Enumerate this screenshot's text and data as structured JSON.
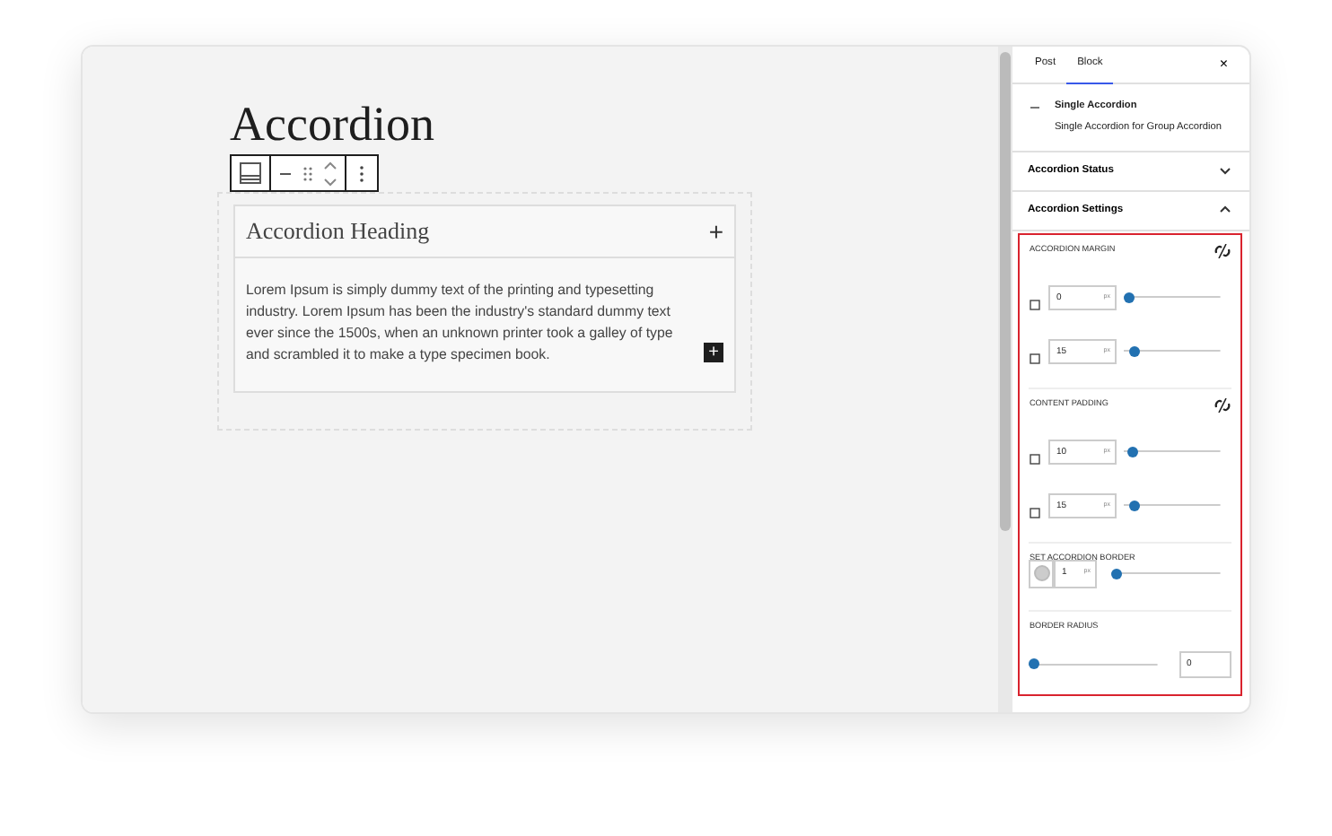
{
  "page_title": "Accordion",
  "accordion": {
    "heading": "Accordion Heading",
    "toggle": "+",
    "expanded": true,
    "body": "Lorem Ipsum is simply dummy text of the printing and typesetting industry. Lorem Ipsum has been the industry's standard dummy text ever since the 1500s, when an unknown printer took a galley of type and scrambled it to make a type specimen book.",
    "add_button": "+"
  },
  "sidebar": {
    "tabs": [
      {
        "label": "Post",
        "selected": false
      },
      {
        "label": "Block",
        "selected": true
      }
    ],
    "close": "×",
    "block": {
      "name": "Single Accordion",
      "description": "Single Accordion for Group Accordion"
    },
    "panels": [
      {
        "title": "Accordion Status",
        "expanded": false
      },
      {
        "title": "Accordion Settings",
        "expanded": true
      }
    ],
    "groups": [
      {
        "kind": "sides",
        "label": "ACCORDION MARGIN",
        "linked": false,
        "rows": [
          {
            "value": "0",
            "unit": "px",
            "level": 0
          },
          {
            "value": "15",
            "unit": "px",
            "level": 0.05
          }
        ]
      },
      {
        "kind": "sides",
        "label": "CONTENT PADDING",
        "linked": false,
        "rows": [
          {
            "value": "10",
            "unit": "px",
            "level": 0.03
          },
          {
            "value": "15",
            "unit": "px",
            "level": 0.05
          }
        ]
      },
      {
        "kind": "border",
        "label": "SET ACCORDION BORDER",
        "color": "#cccccc",
        "value": "1",
        "unit": "px",
        "level": 0
      },
      {
        "kind": "radius",
        "label": "BORDER RADIUS",
        "value": "0",
        "level": 0
      }
    ]
  }
}
